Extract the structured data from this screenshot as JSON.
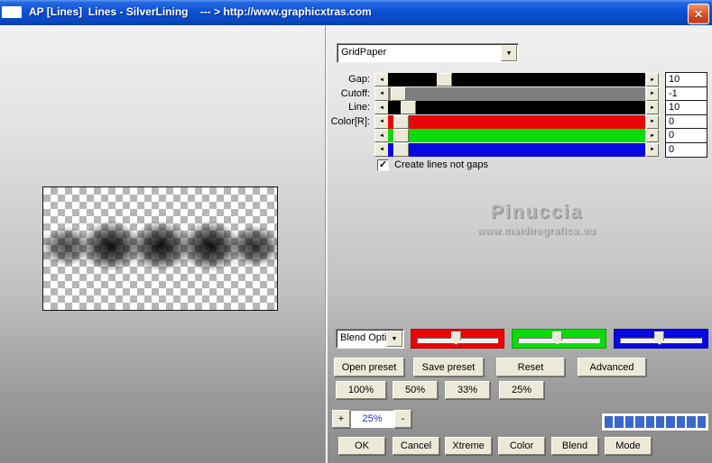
{
  "window": {
    "title": "AP [Lines]  Lines - SilverLining    --- > http://www.graphicxtras.com"
  },
  "icons": {
    "close": "✕",
    "dropdown": "▼",
    "slider_left": "◄",
    "slider_right": "►",
    "check": "✓"
  },
  "preset_dropdown": {
    "value": "GridPaper"
  },
  "sliders": [
    {
      "label": "Gap:",
      "value": "10",
      "track_color": "#000000",
      "thumb_pct": 19
    },
    {
      "label": "Cutoff:",
      "value": "-1",
      "track_color": "#7f7f7f",
      "thumb_pct": 1
    },
    {
      "label": "Line:",
      "value": "10",
      "track_color": "#000000",
      "thumb_pct": 5
    },
    {
      "label": "Color[R]:",
      "value": "0",
      "track_color": "#ea0606",
      "thumb_pct": 2
    },
    {
      "label": "",
      "value": "0",
      "track_color": "#0bdb0b",
      "thumb_pct": 2
    },
    {
      "label": "",
      "value": "0",
      "track_color": "#0808e0",
      "thumb_pct": 2
    }
  ],
  "options": {
    "create_lines_label": "Create lines not gaps",
    "checked": true
  },
  "watermark": {
    "name": "Pinuccia",
    "site": "www.maidiregrafica.eu"
  },
  "blend": {
    "dropdown_value": "Blend Opti",
    "trackbars": [
      {
        "name": "red-channel",
        "color": "#ea0606",
        "thumb_pct": 43
      },
      {
        "name": "green-channel",
        "color": "#0bdb0b",
        "thumb_pct": 43
      },
      {
        "name": "blue-channel",
        "color": "#0808e0",
        "thumb_pct": 43
      }
    ]
  },
  "preset_buttons": {
    "open": "Open preset",
    "save": "Save preset",
    "reset": "Reset",
    "advanced": "Advanced"
  },
  "scale_buttons": {
    "b100": "100%",
    "b50": "50%",
    "b33": "33%",
    "b25": "25%"
  },
  "zoom_control": {
    "plus": "+",
    "value": "25%",
    "minus": "-"
  },
  "progress": {
    "segments": 10,
    "color": "#3a67cb"
  },
  "action_buttons": {
    "ok": "OK",
    "cancel": "Cancel",
    "xtreme": "Xtreme",
    "color": "Color",
    "blend": "Blend",
    "mode": "Mode"
  }
}
